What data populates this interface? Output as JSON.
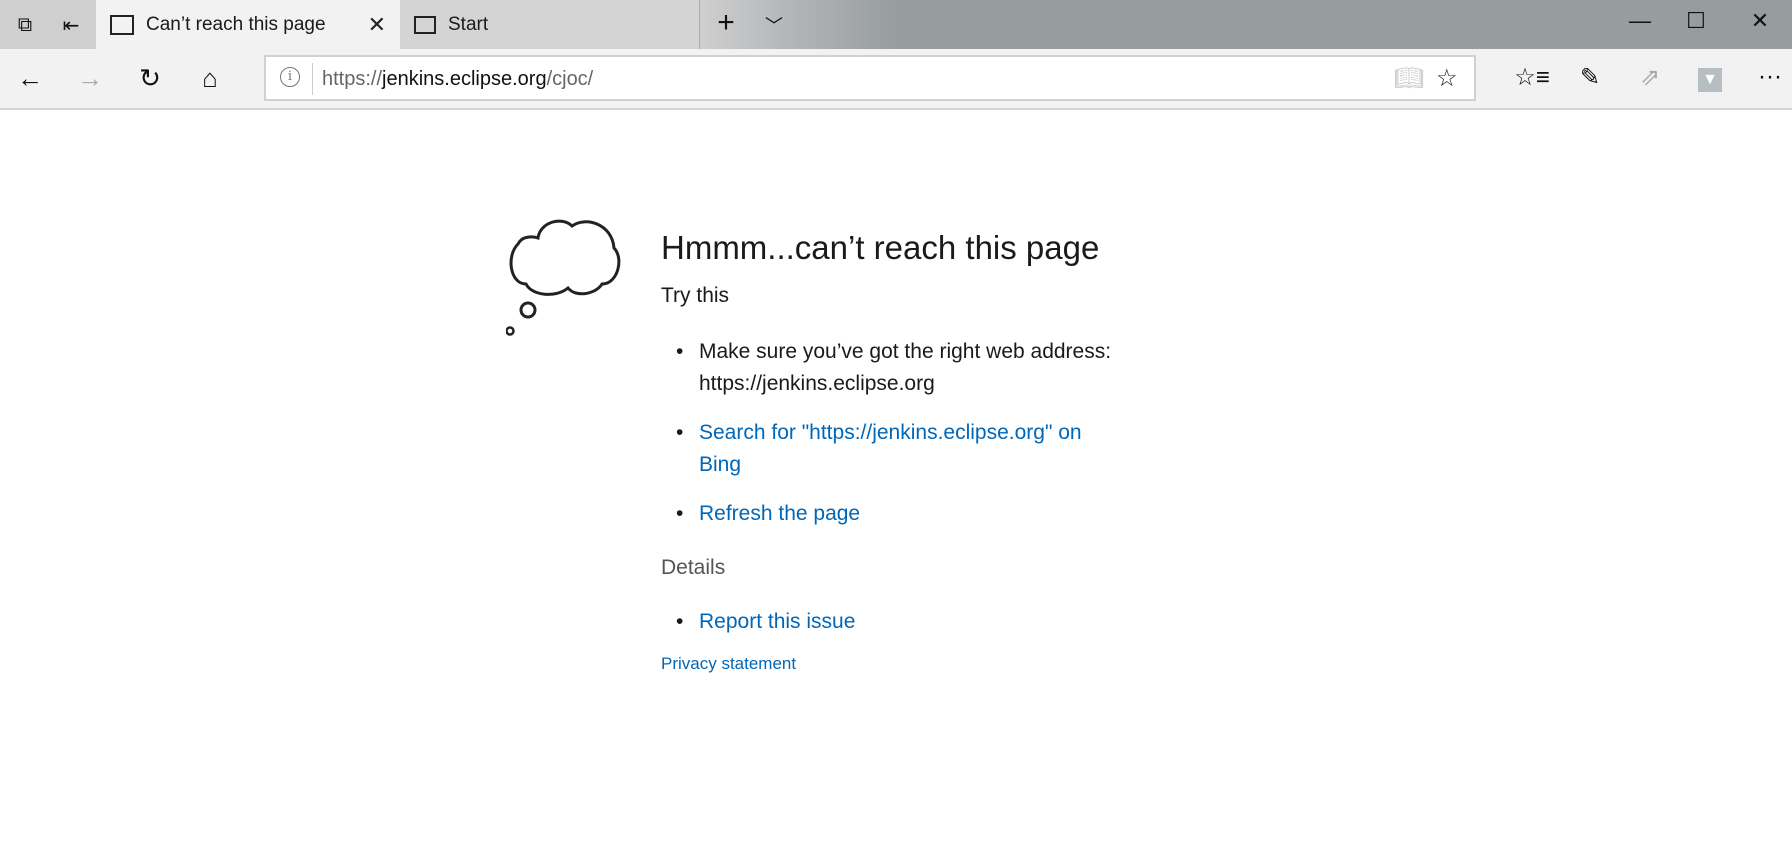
{
  "tabs": [
    {
      "label": "Can’t reach this page",
      "active": true
    },
    {
      "label": "Start",
      "active": false
    }
  ],
  "address": {
    "scheme": "https://",
    "host": "jenkins.eclipse.org",
    "path": "/cjoc/"
  },
  "page": {
    "title": "Hmmm...can’t reach this page",
    "try_this": "Try this",
    "suggestions": [
      "Make sure you’ve got the right web address: https://jenkins.eclipse.org",
      "Search for \"https://jenkins.eclipse.org\" on Bing",
      "Refresh the page"
    ],
    "details": "Details",
    "report": "Report this issue",
    "privacy": "Privacy statement"
  },
  "colors": {
    "link": "#0067b8"
  }
}
